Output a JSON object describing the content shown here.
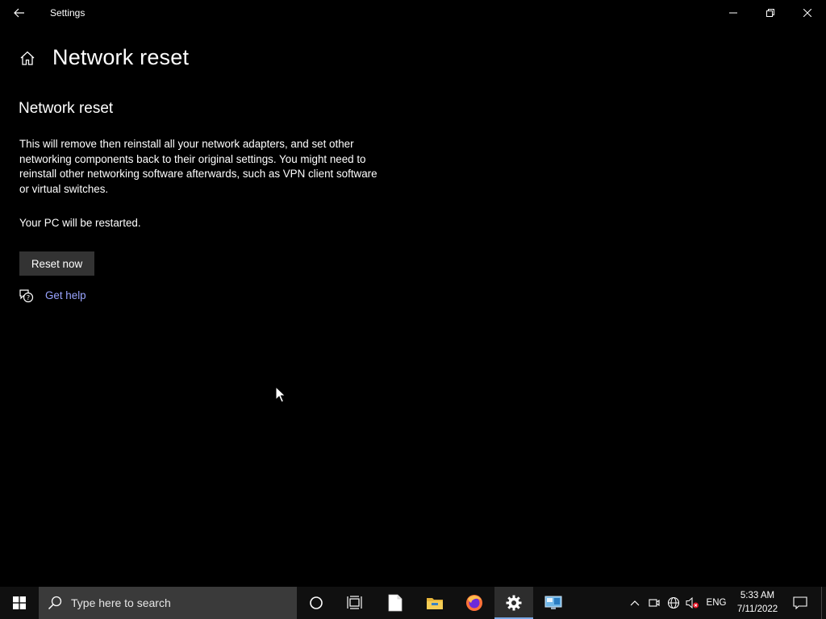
{
  "window": {
    "app_title": "Settings",
    "back_icon": "back-arrow-icon",
    "controls": {
      "minimize_icon": "minimize-icon",
      "maximize_icon": "restore-icon",
      "close_icon": "close-icon"
    }
  },
  "page": {
    "home_icon": "home-icon",
    "title": "Network reset",
    "section_title": "Network reset",
    "description": "This will remove then reinstall all your network adapters, and set other networking components back to their original settings. You might need to reinstall other networking software afterwards, such as VPN client software or virtual switches.",
    "restart_note": "Your PC will be restarted.",
    "reset_button": "Reset now",
    "help_link": "Get help",
    "link_color": "#99a4ff",
    "button_bg": "#333333"
  },
  "taskbar": {
    "search_placeholder": "Type here to search",
    "apps": [
      "cortana-icon",
      "task-view-icon",
      "notepad-icon",
      "file-explorer-icon",
      "firefox-icon",
      "settings-icon",
      "remote-desktop-icon"
    ],
    "tray": {
      "language": "ENG",
      "time": "5:33 AM",
      "date": "7/11/2022"
    }
  }
}
